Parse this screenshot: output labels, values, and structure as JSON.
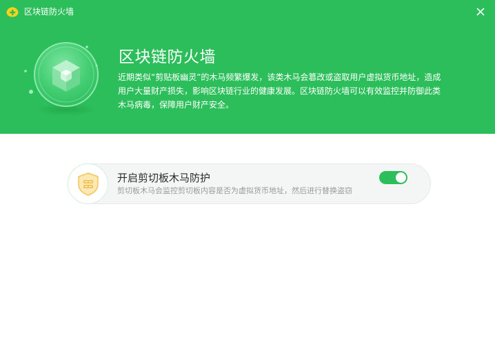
{
  "window": {
    "title": "区块链防火墙",
    "close_label": "×"
  },
  "hero": {
    "title": "区块链防火墙",
    "description": "近期类似“剪贴板幽灵”的木马频繁爆发，该类木马会篡改或盗取用户虚拟货币地址，造成用户大量财产损失，影响区块链行业的健康发展。区块链防火墙可以有效监控并防御此类木马病毒，保障用户财产安全。"
  },
  "protection": {
    "title": "开启剪切板木马防护",
    "description": "剪切板木马会监控剪切板内容是否为虚拟货币地址，然后进行替换盗窃",
    "enabled": true
  },
  "icons": {
    "app": "app-logo-icon",
    "close": "close-icon",
    "hero": "blockchain-cube-icon",
    "card": "shield-icon"
  },
  "colors": {
    "brand": "#2cbe5a",
    "toggle_on": "#2cbe5a",
    "shield": "#f4c45a"
  }
}
